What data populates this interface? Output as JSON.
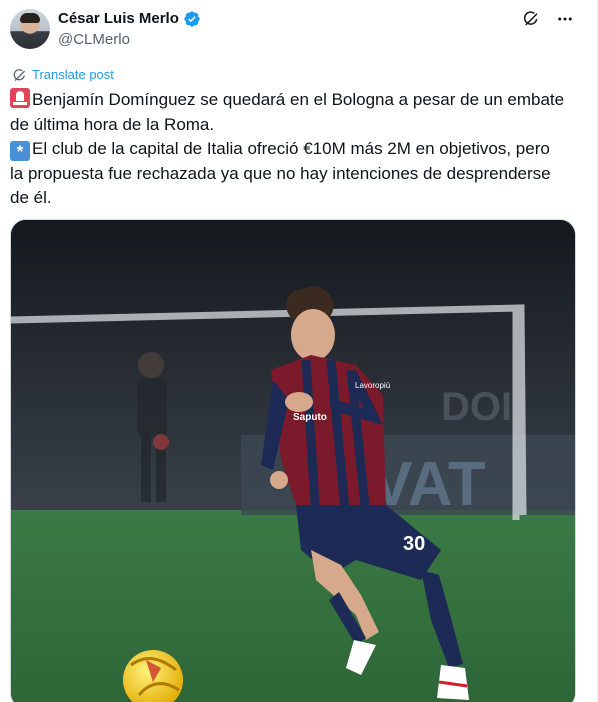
{
  "author": {
    "display_name": "César Luis Merlo",
    "handle": "@CLMerlo",
    "verified": true
  },
  "actions": {
    "grok_icon": "grok-icon",
    "more_icon": "more-icon"
  },
  "translate": {
    "label": "Translate post",
    "icon": "translate-icon"
  },
  "post": {
    "line1": "Benjamín Domínguez se quedará en el Bologna a pesar de un embate",
    "line2": "de última hora de la Roma.",
    "line3": "El club de la capital de Italia ofreció €10M más 2M en objetivos, pero",
    "line4": "la propuesta fue rechazada ya que no hay intenciones de desprenderse",
    "line5": "de él."
  },
  "media": {
    "jersey_number": "30",
    "sponsor": "Lavoropiù",
    "shirt_text": "Saputo"
  },
  "colors": {
    "accent": "#1d9bf0",
    "text": "#0f1419",
    "secondary": "#536471"
  }
}
